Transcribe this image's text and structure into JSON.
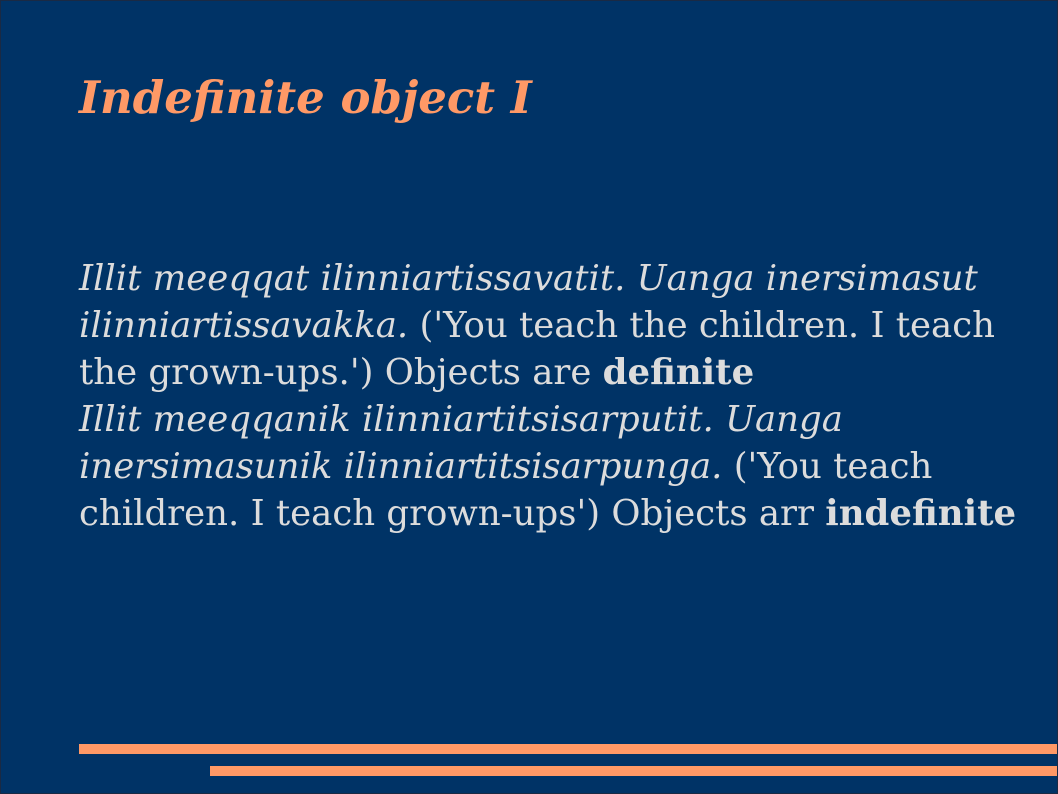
{
  "slide": {
    "title": "Indefinite object I",
    "paragraphs": [
      {
        "italic": "Illit meeqqat ilinniartissavatit. Uanga inersimasut ilinniartissavakka.",
        "plain": " ('You teach the children. I teach the grown-ups.') Objects are ",
        "bold": "definite"
      },
      {
        "italic": "Illit meeqqanik ilinniartitsisarputit. Uanga inersimasunik ilinniartitsisarpunga.",
        "plain": " ('You teach children. I teach grown-ups') Objects arr ",
        "bold": "indefinite"
      }
    ]
  },
  "colors": {
    "background": "#003366",
    "title": "#ff9966",
    "text": "#dcdcdc",
    "accent_bars": "#ff9966"
  }
}
